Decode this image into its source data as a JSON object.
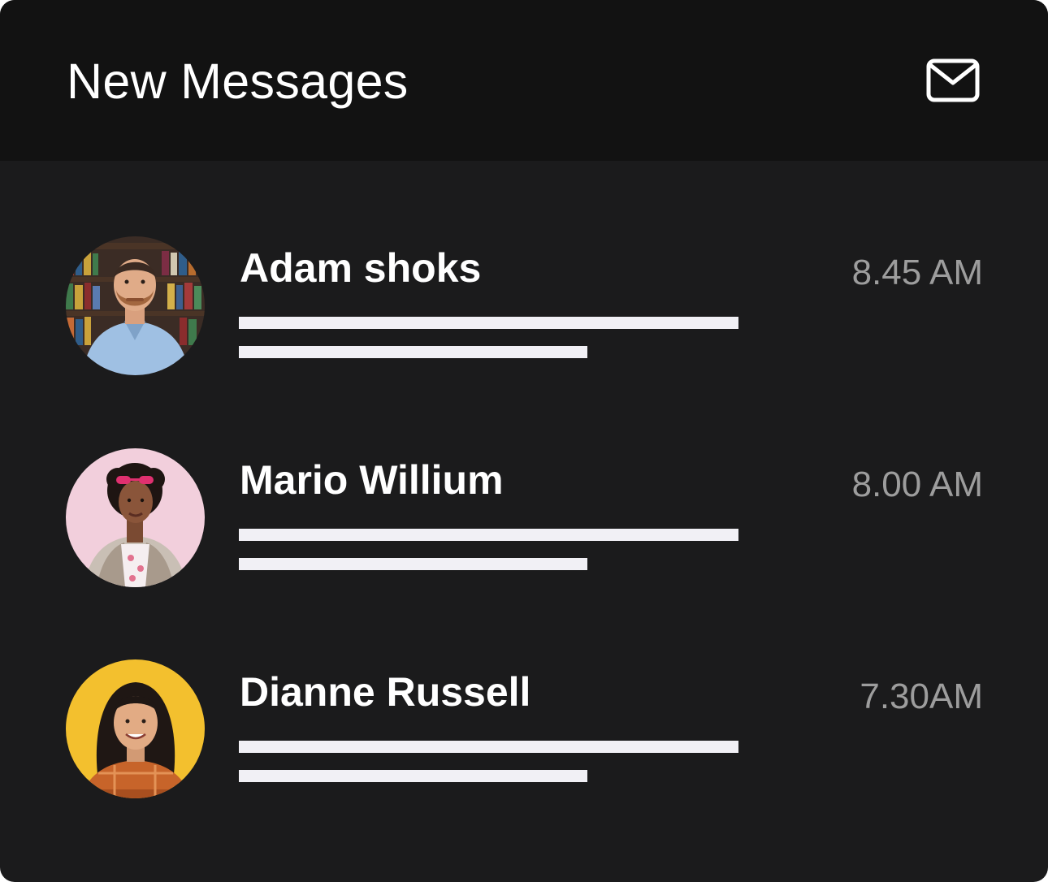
{
  "header": {
    "title": "New Messages",
    "icon": "mail-icon"
  },
  "colors": {
    "card_bg": "#1b1b1c",
    "header_bg": "#121212",
    "title_text": "#ffffff",
    "time_text": "#9d9d9d",
    "placeholder_lines": "#f1f0f5"
  },
  "messages": [
    {
      "name": "Adam shoks",
      "time": "8.45 AM",
      "avatar": "avatar-photo"
    },
    {
      "name": "Mario Willium",
      "time": "8.00 AM",
      "avatar": "avatar-photo"
    },
    {
      "name": "Dianne Russell",
      "time": "7.30AM",
      "avatar": "avatar-photo"
    }
  ]
}
